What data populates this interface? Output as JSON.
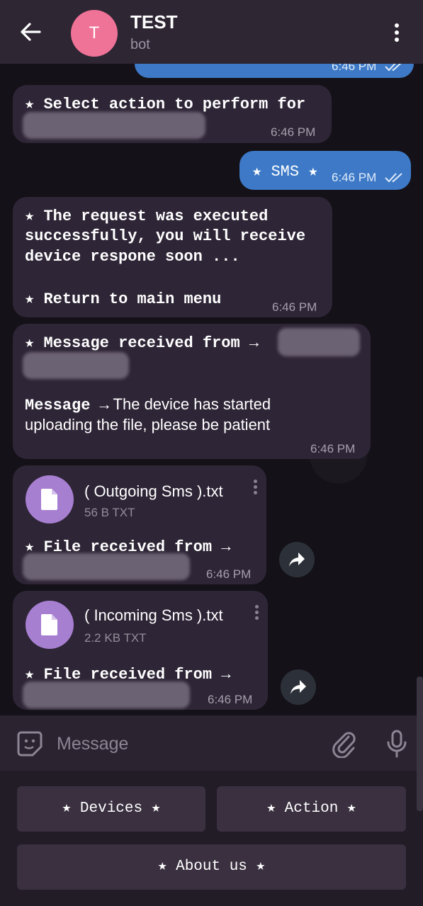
{
  "header": {
    "avatar_letter": "T",
    "title": "TEST",
    "subtitle": "bot"
  },
  "messages": {
    "top_partial_time": "6:46 PM",
    "m1": {
      "text": "★ Select action to perform for",
      "time": "6:46 PM"
    },
    "m2": {
      "text": "★ SMS ★",
      "time": "6:46 PM"
    },
    "m3": {
      "line1": "★ The request was executed",
      "line2": "successfully, you will receive",
      "line3": "device respone soon ...",
      "line4": "★ Return to main menu",
      "time": "6:46 PM"
    },
    "m4": {
      "line1": "★ Message received from →",
      "label": "Message →",
      "body1": " The device has started",
      "body2": "uploading the file, please be patient",
      "time": "6:46 PM"
    },
    "f1": {
      "name": "( Outgoing Sms ).txt",
      "size": "56 B TXT",
      "caption": "★ File received from →",
      "time": "6:46 PM"
    },
    "f2": {
      "name": "( Incoming Sms ).txt",
      "size": "2.2 KB TXT",
      "caption": "★ File received from →",
      "time": "6:46 PM"
    }
  },
  "composer": {
    "placeholder": "Message"
  },
  "keyboard": {
    "devices": "★ Devices ★",
    "action": "★ Action ★",
    "about": "★ About us ★"
  },
  "colors": {
    "outgoing": "#3d79c6",
    "incoming": "#2e2536",
    "avatar": "#ef7297",
    "file_icon": "#a77fd1"
  }
}
